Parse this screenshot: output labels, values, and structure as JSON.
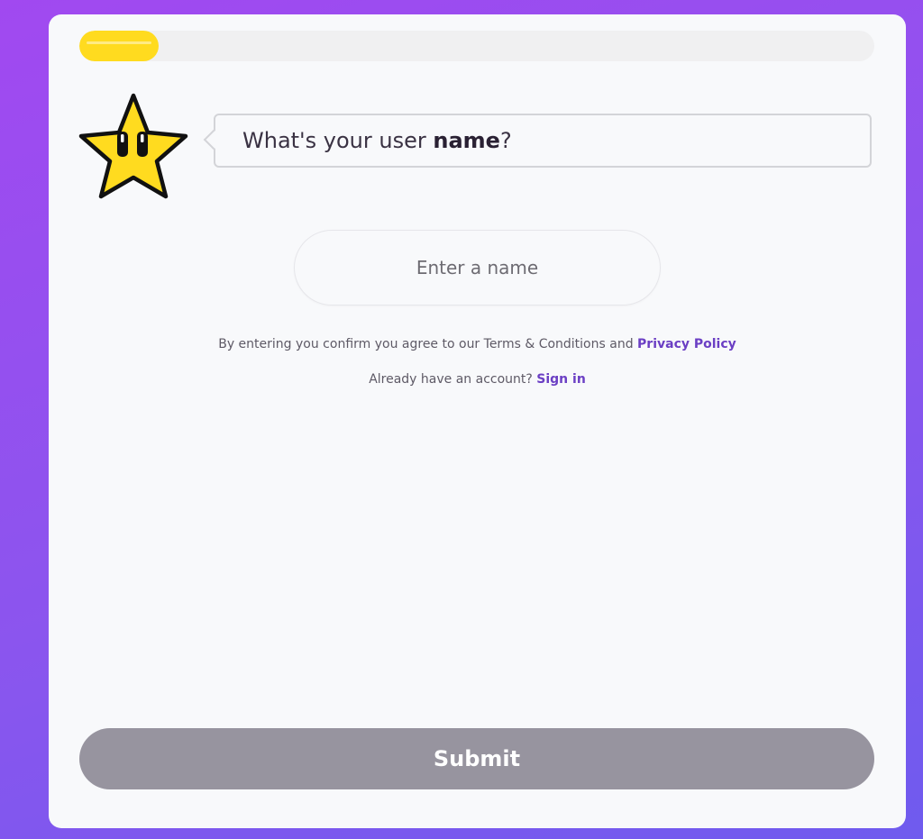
{
  "progress": {
    "value_percent": 10,
    "fill_color": "#ffdb1f",
    "track_color": "#f0f0f1"
  },
  "mascot": {
    "icon": "star-mascot-icon",
    "color": "#ffdb1f"
  },
  "question": {
    "prefix": "What's your user ",
    "emphasis": "name",
    "suffix": "?"
  },
  "name_input": {
    "placeholder": "Enter a name",
    "value": ""
  },
  "terms": {
    "text": "By entering you confirm you agree to our Terms & Conditions and ",
    "link_label": "Privacy Policy"
  },
  "signin": {
    "prompt": "Already have an account? ",
    "link_label": "Sign in"
  },
  "submit": {
    "label": "Submit",
    "color": "#97949f"
  },
  "colors": {
    "accent": "#6b3fc4",
    "background_gradient_start": "#a149f0",
    "background_gradient_end": "#6f5bee"
  }
}
